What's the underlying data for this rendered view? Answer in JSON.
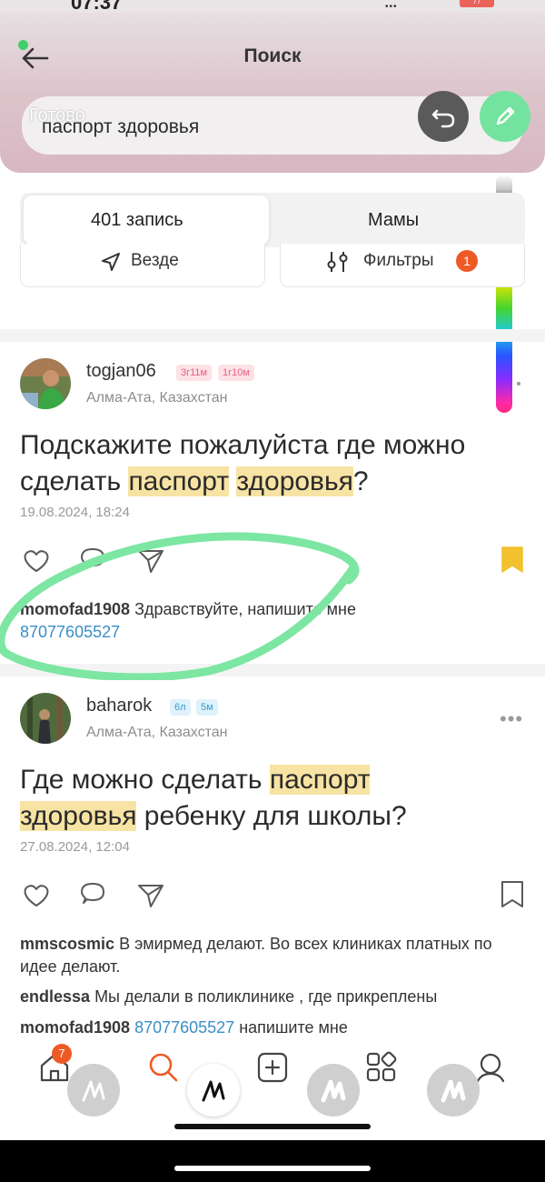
{
  "status": {
    "time": "07:37",
    "signal": "•••",
    "battery": "77"
  },
  "header": {
    "title": "Поиск",
    "search_value": "паспорт здоровья",
    "done_label": "Готово"
  },
  "tabs": [
    {
      "label": "401 запись",
      "active": true
    },
    {
      "label": "Мамы",
      "active": false
    }
  ],
  "filters": {
    "location_label": "Везде",
    "filters_label": "Фильтры",
    "filters_count": "1"
  },
  "posts": [
    {
      "username": "togjan06",
      "badges": [
        "3г11м",
        "1г10м"
      ],
      "location": "Алма-Ата, Казахстан",
      "text_line1_before": "Подскажите пожалуйста где можно",
      "text_line2_before": "сделать ",
      "hl1": "паспорт",
      "hl2": "здоровья",
      "text_line2_after": "?",
      "date": "19.08.2024, 18:24",
      "bookmarked": true,
      "comments": [
        {
          "user": "momofad1908",
          "text": "Здравствуйте, напишите мне",
          "phone": "87077605527"
        }
      ]
    },
    {
      "username": "baharok",
      "badges": [
        "6л",
        "5м"
      ],
      "location": "Алма-Ата, Казахстан",
      "text_line1_before": "Где можно сделать ",
      "hl1": "паспорт",
      "hl2": "здоровья",
      "text_line2_after": " ребенку для школы?",
      "date": "27.08.2024, 12:04",
      "bookmarked": false,
      "comments": [
        {
          "user": "mmscosmic",
          "text": "В эмирмед делают. Во всех клиниках платных по идее делают."
        },
        {
          "user": "endlessa",
          "text": "Мы делали в поликлинике , где прикреплены"
        },
        {
          "user": "momofad1908",
          "phone": "87077605527",
          "text": "напишите мне"
        }
      ]
    }
  ],
  "nav": {
    "home_badge": "7"
  },
  "colors": {
    "accent_orange": "#ee5a26",
    "pen_green": "#74e39f",
    "highlight": "#f7e3a3",
    "link_blue": "#3a8fc6",
    "bookmark_yellow": "#f2c12e"
  }
}
